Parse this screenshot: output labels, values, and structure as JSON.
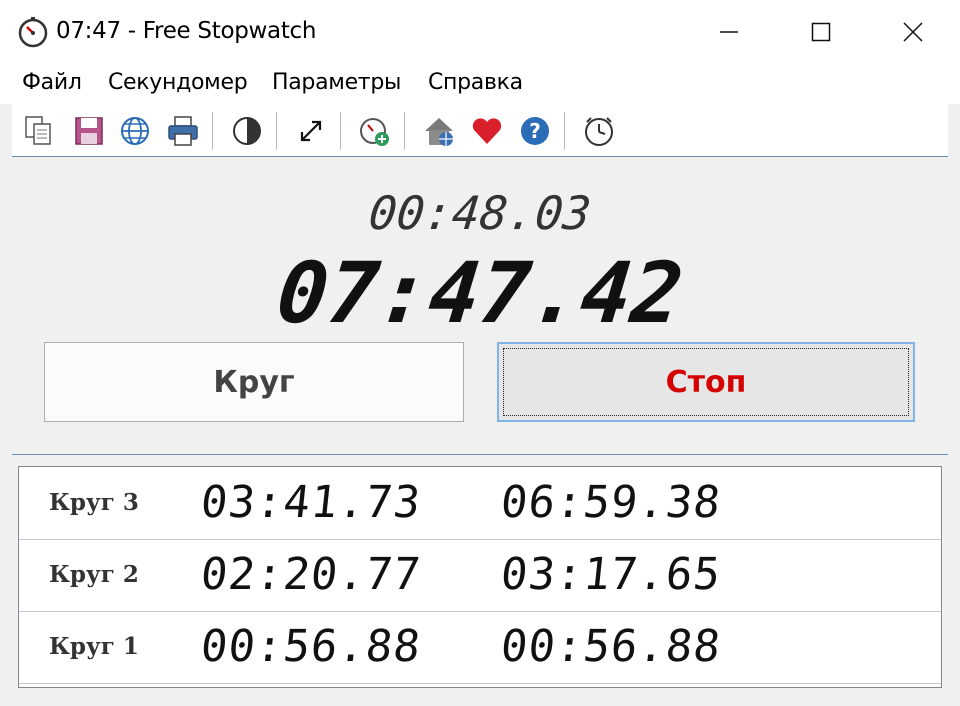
{
  "window": {
    "title": "07:47 - Free Stopwatch"
  },
  "menu": [
    "Файл",
    "Секундомер",
    "Параметры",
    "Справка"
  ],
  "toolbar_icons": [
    "copy-icon",
    "save-icon",
    "globe-icon",
    "print-icon",
    "contrast-icon",
    "fullscreen-icon",
    "add-timer-icon",
    "home-icon",
    "heart-icon",
    "help-icon",
    "clock-icon"
  ],
  "display": {
    "lap_time": "00:48.03",
    "main_time": "07:47.42"
  },
  "buttons": {
    "lap_label": "Круг",
    "stop_label": "Стоп"
  },
  "colors": {
    "stop_text": "#d40000",
    "accent_border": "#7eb4ea"
  },
  "laps": [
    {
      "label": "Круг 3",
      "lap": "03:41.73",
      "total": "06:59.38"
    },
    {
      "label": "Круг 2",
      "lap": "02:20.77",
      "total": "03:17.65"
    },
    {
      "label": "Круг 1",
      "lap": "00:56.88",
      "total": "00:56.88"
    }
  ]
}
